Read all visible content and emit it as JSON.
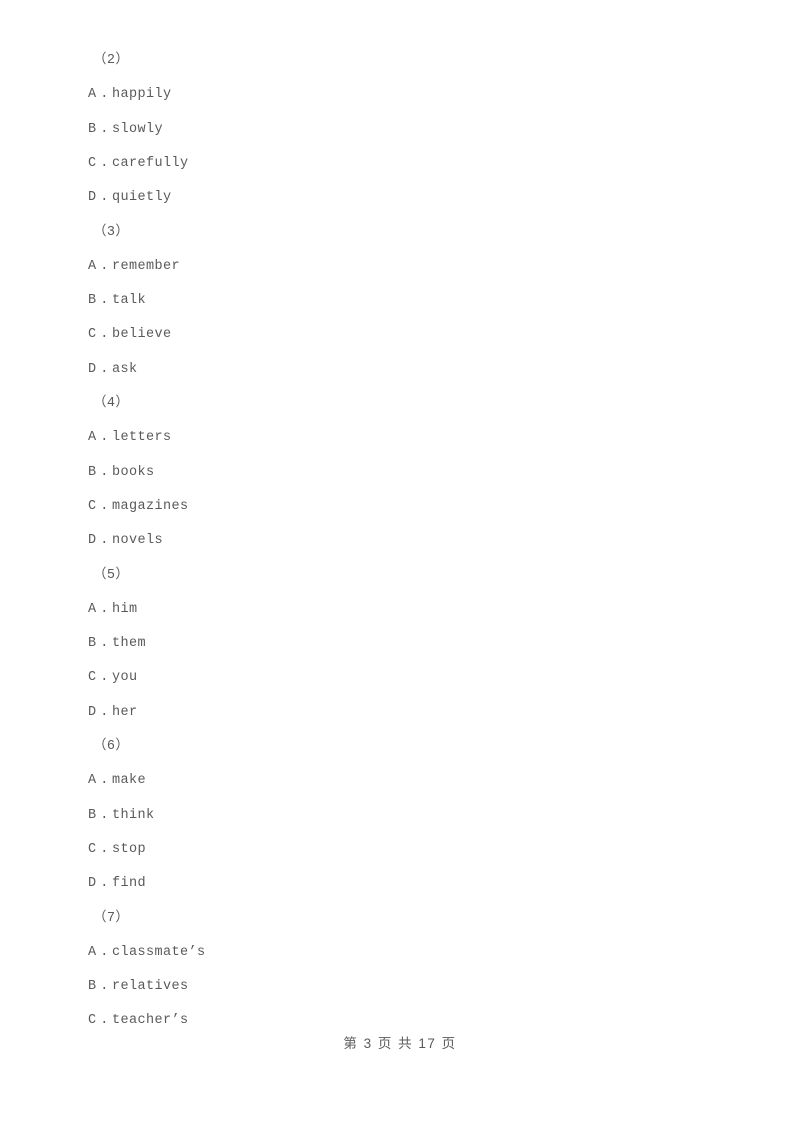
{
  "document": {
    "type": "exam-paper",
    "page_background": "#ffffff",
    "text_color": "#5a5a5a",
    "questions": [
      {
        "number": "（2）",
        "options": [
          {
            "letter": "A",
            "separator": ".",
            "text": "happily"
          },
          {
            "letter": "B",
            "separator": ".",
            "text": "slowly"
          },
          {
            "letter": "C",
            "separator": ".",
            "text": "carefully"
          },
          {
            "letter": "D",
            "separator": ".",
            "text": "quietly"
          }
        ]
      },
      {
        "number": "（3）",
        "options": [
          {
            "letter": "A",
            "separator": ".",
            "text": "remember"
          },
          {
            "letter": "B",
            "separator": ".",
            "text": "talk"
          },
          {
            "letter": "C",
            "separator": ".",
            "text": "believe"
          },
          {
            "letter": "D",
            "separator": ".",
            "text": "ask"
          }
        ]
      },
      {
        "number": "（4）",
        "options": [
          {
            "letter": "A",
            "separator": ".",
            "text": "letters"
          },
          {
            "letter": "B",
            "separator": ".",
            "text": "books"
          },
          {
            "letter": "C",
            "separator": ".",
            "text": "magazines"
          },
          {
            "letter": "D",
            "separator": ".",
            "text": "novels"
          }
        ]
      },
      {
        "number": "（5）",
        "options": [
          {
            "letter": "A",
            "separator": ".",
            "text": "him"
          },
          {
            "letter": "B",
            "separator": ".",
            "text": "them"
          },
          {
            "letter": "C",
            "separator": ".",
            "text": "you"
          },
          {
            "letter": "D",
            "separator": ".",
            "text": "her"
          }
        ]
      },
      {
        "number": "（6）",
        "options": [
          {
            "letter": "A",
            "separator": ".",
            "text": "make"
          },
          {
            "letter": "B",
            "separator": ".",
            "text": "think"
          },
          {
            "letter": "C",
            "separator": ".",
            "text": "stop"
          },
          {
            "letter": "D",
            "separator": ".",
            "text": "find"
          }
        ]
      },
      {
        "number": "（7）",
        "options": [
          {
            "letter": "A",
            "separator": ".",
            "text": "classmate’s"
          },
          {
            "letter": "B",
            "separator": ".",
            "text": "relatives"
          },
          {
            "letter": "C",
            "separator": ".",
            "text": "teacher’s"
          }
        ]
      }
    ],
    "footer": {
      "text": "第 3 页 共 17 页",
      "current_page": "3",
      "total_pages": "17"
    }
  }
}
